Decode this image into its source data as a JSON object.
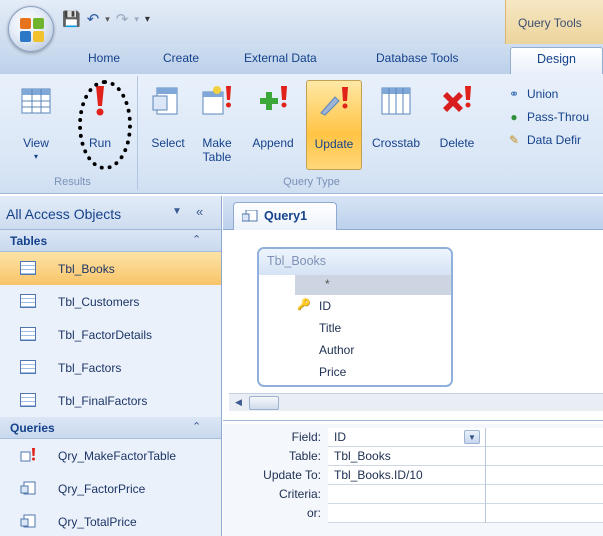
{
  "window": {
    "context_tab_title": "Query Tools"
  },
  "tabs": [
    "Home",
    "Create",
    "External Data",
    "Database Tools"
  ],
  "active_tab": "Design",
  "ribbon": {
    "results": {
      "label": "Results",
      "buttons": [
        {
          "label": "View",
          "icon": "datasheet-view-icon"
        },
        {
          "label": "Run",
          "icon": "exclamation-run-icon"
        }
      ]
    },
    "query_type": {
      "label": "Query Type",
      "buttons": [
        {
          "label": "Select",
          "icon": "select-query-icon"
        },
        {
          "label": "Make\nTable",
          "icon": "make-table-icon"
        },
        {
          "label": "Append",
          "icon": "append-query-icon"
        },
        {
          "label": "Update",
          "icon": "update-query-icon",
          "active": true
        },
        {
          "label": "Crosstab",
          "icon": "crosstab-query-icon"
        },
        {
          "label": "Delete",
          "icon": "delete-query-icon"
        }
      ],
      "small_buttons": [
        {
          "label": "Union",
          "icon": "union-icon"
        },
        {
          "label": "Pass-Throu",
          "icon": "globe-icon"
        },
        {
          "label": "Data Defir",
          "icon": "pencil-icon"
        }
      ]
    }
  },
  "nav": {
    "title": "All Access Objects",
    "sections": [
      {
        "title": "Tables",
        "items": [
          {
            "label": "Tbl_Books",
            "selected": true
          },
          {
            "label": "Tbl_Customers"
          },
          {
            "label": "Tbl_FactorDetails"
          },
          {
            "label": "Tbl_Factors"
          },
          {
            "label": "Tbl_FinalFactors"
          }
        ]
      },
      {
        "title": "Queries",
        "items": [
          {
            "label": "Qry_MakeFactorTable"
          },
          {
            "label": "Qry_FactorPrice"
          },
          {
            "label": "Qry_TotalPrice"
          }
        ]
      }
    ]
  },
  "document": {
    "tab": "Query1",
    "field_list": {
      "table": "Tbl_Books",
      "star": "*",
      "fields": [
        "ID",
        "Title",
        "Author",
        "Price"
      ],
      "key_field": "ID"
    },
    "grid": {
      "labels": [
        "Field:",
        "Table:",
        "Update To:",
        "Criteria:",
        "or:"
      ],
      "values": [
        "ID",
        "Tbl_Books",
        "Tbl_Books.ID/10",
        "",
        ""
      ]
    }
  },
  "colors": {
    "accent": "#15428b",
    "active_highlight": "#ffc444",
    "run_icon": "#e0221a"
  }
}
